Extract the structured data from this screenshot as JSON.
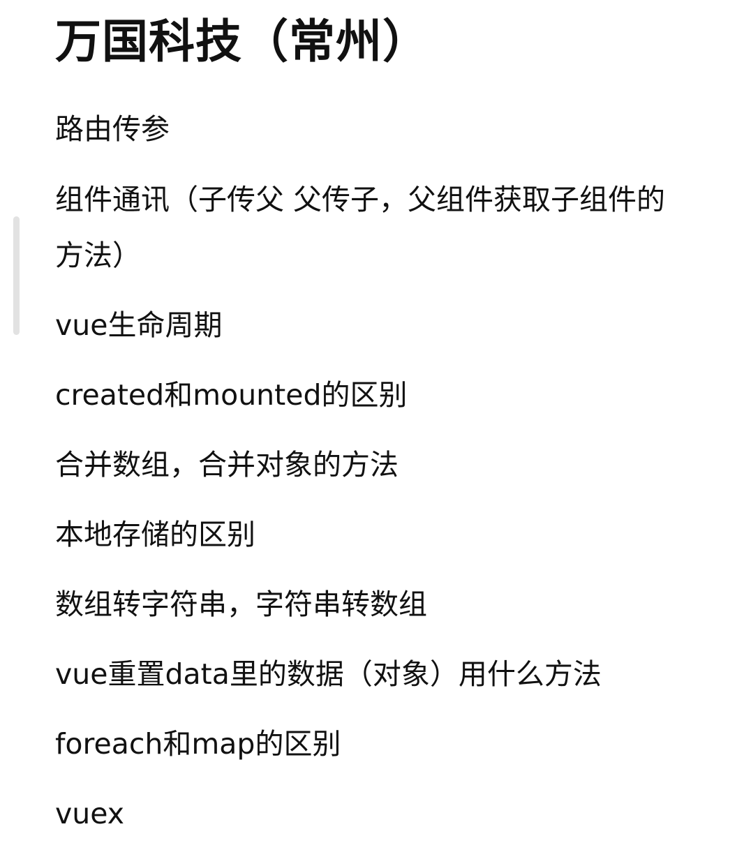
{
  "document": {
    "title": "万国科技（常州）",
    "items": [
      "路由传参",
      "组件通讯（子传父 父传子，父组件获取子组件的方法）",
      "vue生命周期",
      "created和mounted的区别",
      "合并数组，合并对象的方法",
      "本地存储的区别",
      "数组转字符串，字符串转数组",
      "vue重置data里的数据（对象）用什么方法",
      "foreach和map的区别",
      "vuex"
    ]
  }
}
